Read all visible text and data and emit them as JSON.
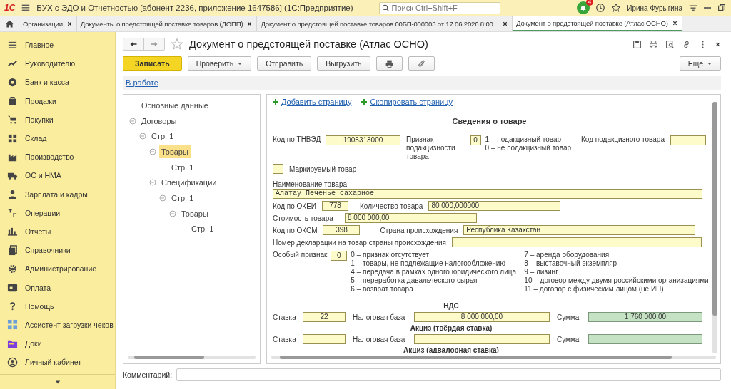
{
  "window": {
    "logo": "1С",
    "title": "БУХ с ЭДО и Отчетностью [абонент 2236, приложение 1647586]  (1С:Предприятие)",
    "search": {
      "placeholder": "Поиск Ctrl+Shift+F"
    },
    "notifications": "4",
    "user": "Ирина Фурыгина"
  },
  "tabs": [
    {
      "label": "Организации",
      "selected": false
    },
    {
      "label": "Документы о предстоящей поставке товаров (ДОПП)",
      "selected": false
    },
    {
      "label": "Документ о предстоящей поставке товаров 00БП-000003 от 17.06.2026 8:00...",
      "selected": false
    },
    {
      "label": "Документ о предстоящей поставке (Атлас ОСНО)",
      "selected": true
    }
  ],
  "sidebar": {
    "items": [
      {
        "label": "Главное"
      },
      {
        "label": "Руководителю"
      },
      {
        "label": "Банк и касса"
      },
      {
        "label": "Продажи"
      },
      {
        "label": "Покупки"
      },
      {
        "label": "Склад"
      },
      {
        "label": "Производство"
      },
      {
        "label": "ОС и НМА"
      },
      {
        "label": "Зарплата и кадры"
      },
      {
        "label": "Операции"
      },
      {
        "label": "Отчеты"
      },
      {
        "label": "Справочники"
      },
      {
        "label": "Администрирование"
      },
      {
        "label": "Оплата"
      },
      {
        "label": "Помощь"
      },
      {
        "label": "Ассистент загрузки чеков"
      },
      {
        "label": "Доки"
      },
      {
        "label": "Личный кабинет"
      }
    ]
  },
  "document": {
    "title": "Документ о предстоящей поставке (Атлас ОСНО)",
    "buttons": [
      {
        "label": "Записать",
        "kind": "primary"
      },
      {
        "label": "Проверить",
        "kind": "dropdown"
      },
      {
        "label": "Отправить",
        "kind": "plain"
      },
      {
        "label": "Выгрузить",
        "kind": "plain"
      },
      {
        "kind": "print"
      },
      {
        "kind": "attach"
      }
    ],
    "more_button": "Еще",
    "status_link": "В работе",
    "tree": [
      {
        "label": "Основные данные",
        "selected": false
      },
      {
        "label": "Договоры",
        "selected": false,
        "children": [
          {
            "label": "Стр. 1",
            "selected": false,
            "children": [
              {
                "label": "Товары",
                "selected": true,
                "children": [
                  {
                    "label": "Стр. 1",
                    "selected": false
                  }
                ]
              },
              {
                "label": "Спецификации",
                "selected": false,
                "children": [
                  {
                    "label": "Стр. 1",
                    "selected": false,
                    "children": [
                      {
                        "label": "Товары",
                        "selected": false,
                        "children": [
                          {
                            "label": "Стр. 1",
                            "selected": false
                          }
                        ]
                      }
                    ]
                  }
                ]
              }
            ]
          }
        ]
      }
    ],
    "page_actions": [
      "Добавить страницу",
      "Скопировать страницу"
    ],
    "form": {
      "heading": "Сведения о товаре",
      "tnved": {
        "label": "Код по ТНВЭД",
        "value": "1905313000"
      },
      "excise_flag": {
        "label": "Признак подакцизности товара",
        "value": "0",
        "options": [
          "1 – подакцизный товар",
          "0 – не подакцизный товар"
        ]
      },
      "excise_code": {
        "label": "Код подакцизного товара"
      },
      "marked": {
        "label": "Маркируемый товар",
        "checked": false
      },
      "name": {
        "label": "Наименование товара",
        "value": "Алатау Печенье сахарное"
      },
      "okei": {
        "label": "Код по ОКЕИ",
        "value": "778"
      },
      "quantity": {
        "label": "Количество товара",
        "value": "80 000,000000"
      },
      "cost": {
        "label": "Стоимость товара",
        "value": "8 000 000,00"
      },
      "oksm": {
        "label": "Код по ОКСМ",
        "value": "398"
      },
      "country": {
        "label": "Страна происхождения",
        "value": "Республика Казахстан"
      },
      "declaration": {
        "label": "Номер декларации на товар страны происхождения"
      },
      "special": {
        "label": "Особый признак",
        "value": "0",
        "options_left": [
          "0 – признак отсутствует",
          "1 – товары, не подлежащие налогообложению",
          "4 – передача в рамках одного юридического лица",
          "5 – переработка давальческого сырья",
          "6 – возврат товара"
        ],
        "options_right": [
          "7 – аренда оборудования",
          "8 – выставочный экземпляр",
          "9 – лизинг",
          "10 – договор между двумя российскими организациями",
          "11 – договор с физическим лицом (не ИП)"
        ]
      },
      "taxes": [
        {
          "title": "НДС",
          "rate_label": "Ставка",
          "rate": "22",
          "base_label": "Налоговая база",
          "base": "8 000 000,00",
          "sum_label": "Сумма",
          "sum": "1 760 000,00"
        },
        {
          "title": "Акциз (твёрдая ставка)",
          "rate_label": "Ставка",
          "base_label": "Налоговая база",
          "sum_label": "Сумма"
        },
        {
          "title": "Акциз (адвалорная ставка)"
        }
      ]
    }
  },
  "comment": {
    "label": "Комментарий:"
  }
}
